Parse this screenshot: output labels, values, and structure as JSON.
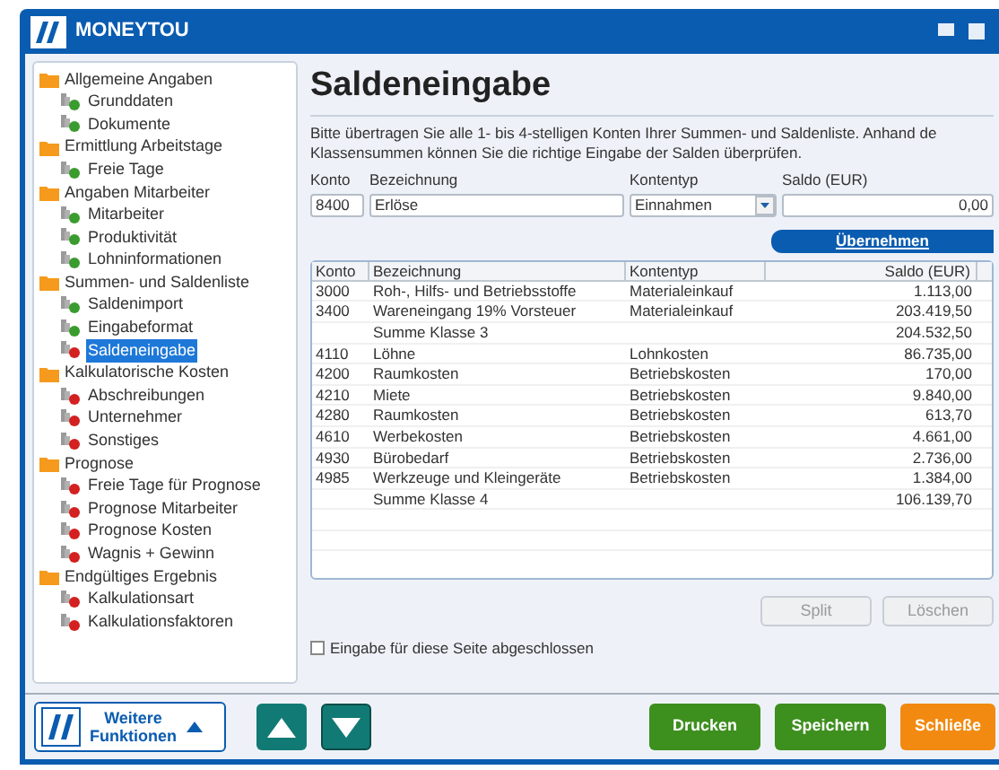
{
  "window": {
    "title": "MONEYTOU"
  },
  "sidebar": {
    "groups": [
      {
        "label": "Allgemeine Angaben",
        "children": [
          {
            "label": "Grunddaten",
            "done": true,
            "selected": false
          },
          {
            "label": "Dokumente",
            "done": true,
            "selected": false
          }
        ]
      },
      {
        "label": "Ermittlung Arbeitstage",
        "children": [
          {
            "label": "Freie Tage",
            "done": true,
            "selected": false
          }
        ]
      },
      {
        "label": "Angaben Mitarbeiter",
        "children": [
          {
            "label": "Mitarbeiter",
            "done": true,
            "selected": false
          },
          {
            "label": "Produktivität",
            "done": true,
            "selected": false
          },
          {
            "label": "Lohninformationen",
            "done": true,
            "selected": false
          }
        ]
      },
      {
        "label": "Summen- und Saldenliste",
        "children": [
          {
            "label": "Saldenimport",
            "done": true,
            "selected": false
          },
          {
            "label": "Eingabeformat",
            "done": true,
            "selected": false
          },
          {
            "label": "Saldeneingabe",
            "done": false,
            "selected": true
          }
        ]
      },
      {
        "label": "Kalkulatorische Kosten",
        "children": [
          {
            "label": "Abschreibungen",
            "done": false,
            "selected": false
          },
          {
            "label": "Unternehmer",
            "done": false,
            "selected": false
          },
          {
            "label": "Sonstiges",
            "done": false,
            "selected": false
          }
        ]
      },
      {
        "label": "Prognose",
        "children": [
          {
            "label": "Freie Tage für Prognose",
            "done": false,
            "selected": false
          },
          {
            "label": "Prognose Mitarbeiter",
            "done": false,
            "selected": false
          },
          {
            "label": "Prognose Kosten",
            "done": false,
            "selected": false
          },
          {
            "label": "Wagnis + Gewinn",
            "done": false,
            "selected": false
          }
        ]
      },
      {
        "label": "Endgültiges Ergebnis",
        "children": [
          {
            "label": "Kalkulationsart",
            "done": false,
            "selected": false
          },
          {
            "label": "Kalkulationsfaktoren",
            "done": false,
            "selected": false
          }
        ]
      }
    ]
  },
  "heading": "Saldeneingabe",
  "intro_lines": [
    "Bitte übertragen Sie alle 1- bis 4-stelligen Konten Ihrer Summen- und Saldenliste. Anhand de",
    "Klassensummen können Sie die richtige Eingabe der Salden überprüfen."
  ],
  "form": {
    "konto": {
      "label": "Konto",
      "value": "8400"
    },
    "bezeichnung": {
      "label": "Bezeichnung",
      "value": "Erlöse"
    },
    "kontentyp": {
      "label": "Kontentyp",
      "value": "Einnahmen"
    },
    "saldo": {
      "label": "Saldo (EUR)",
      "value": "0,00"
    }
  },
  "apply_button": "Übernehmen",
  "table": {
    "columns": [
      "Konto",
      "Bezeichnung",
      "Kontentyp",
      "Saldo (EUR)"
    ],
    "rows": [
      [
        "3000",
        "Roh-, Hilfs- und Betriebsstoffe",
        "Materialeinkauf",
        "1.113,00"
      ],
      [
        "3400",
        "Wareneingang 19% Vorsteuer",
        "Materialeinkauf",
        "203.419,50"
      ],
      [
        "",
        "Summe Klasse 3",
        "",
        "204.532,50"
      ],
      [
        "4110",
        "Löhne",
        "Lohnkosten",
        "86.735,00"
      ],
      [
        "4200",
        "Raumkosten",
        "Betriebskosten",
        "170,00"
      ],
      [
        "4210",
        "Miete",
        "Betriebskosten",
        "9.840,00"
      ],
      [
        "4280",
        "Raumkosten",
        "Betriebskosten",
        "613,70"
      ],
      [
        "4610",
        "Werbekosten",
        "Betriebskosten",
        "4.661,00"
      ],
      [
        "4930",
        "Bürobedarf",
        "Betriebskosten",
        "2.736,00"
      ],
      [
        "4985",
        "Werkzeuge und Kleingeräte",
        "Betriebskosten",
        "1.384,00"
      ],
      [
        "",
        "Summe Klasse 4",
        "",
        "106.139,70"
      ]
    ]
  },
  "split_button": {
    "label": "Split",
    "disabled": true
  },
  "delete_button": {
    "label": "Löschen",
    "disabled": true
  },
  "done_checkbox": {
    "label": "Eingabe für diese Seite abgeschlossen",
    "checked": false
  },
  "more_button": {
    "line1": "Weitere",
    "line2": "Funktionen"
  },
  "footer_buttons": [
    {
      "label": "Drucken",
      "kind": "green"
    },
    {
      "label": "Speichern",
      "kind": "green"
    },
    {
      "label": "Schließe",
      "kind": "orange"
    }
  ]
}
